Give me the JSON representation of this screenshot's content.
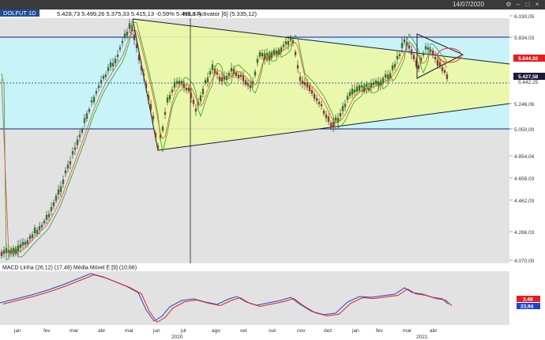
{
  "window": {
    "date": "14/07/2020"
  },
  "info": {
    "symbol": "DOLFUT 1D",
    "ohlc": "5.428,73  5.499,26  5.375,33  5.415,13  -0,59%  5.498,37)",
    "indicator": "HiLo Activator [6] (5.335,12)"
  },
  "price_axis": [
    "6.030,05",
    "5.834,03",
    "5.246,06",
    "5.050,00",
    "4.854,04",
    "4.658,03",
    "4.462,03",
    "4.266,03",
    "4.070,00"
  ],
  "price_tags": {
    "red": "5.644,92",
    "dark": "5.427,58",
    "dark2": "5.442,25"
  },
  "macd": {
    "label": "MACD Linha (26,12) (17,48)  Média Móvel E [9] (10,66)",
    "tag_red": "3,48",
    "tag_blue": "23,94"
  },
  "months": [
    "jan",
    "fev",
    "mar",
    "abr",
    "mai",
    "jun",
    "jul",
    "ago",
    "set",
    "out",
    "nov",
    "dez",
    "jan",
    "fev",
    "mar",
    "abr"
  ],
  "years": [
    "2020",
    "2021"
  ],
  "colors": {
    "band": "#c8f4f7",
    "triangle": "#edf8a4",
    "up": "#2a8f1a",
    "down": "#c03030"
  }
}
